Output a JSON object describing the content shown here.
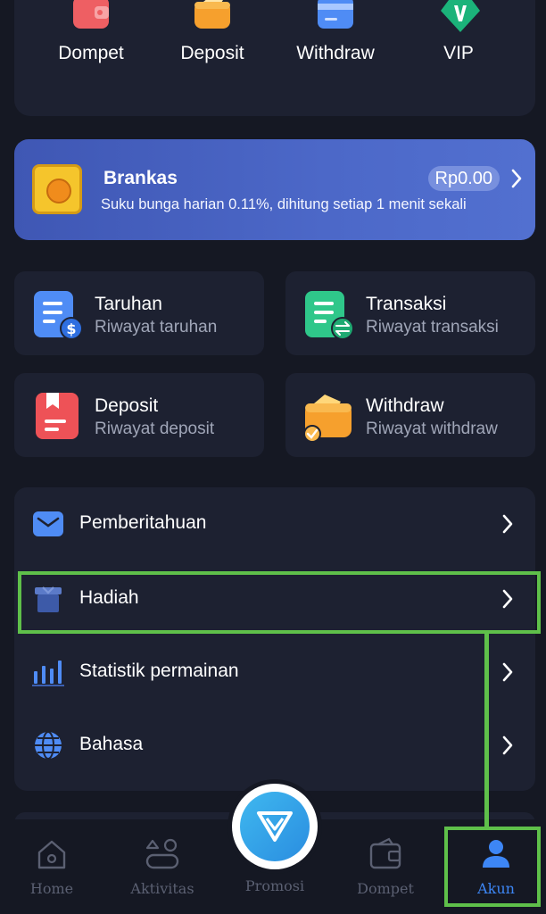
{
  "quick_actions": [
    {
      "label": "Dompet",
      "icon": "wallet-icon",
      "color": "#ee5f63"
    },
    {
      "label": "Deposit",
      "icon": "deposit-icon",
      "color": "#f6a02d"
    },
    {
      "label": "Withdraw",
      "icon": "card-icon",
      "color": "#4f8cf5"
    },
    {
      "label": "VIP",
      "icon": "vip-shield-icon",
      "color": "#1bb37a"
    }
  ],
  "brankas": {
    "title": "Brankas",
    "description": "Suku bunga harian 0.11%, dihitung setiap 1 menit sekali",
    "balance": "Rp0.00",
    "icon": "safe-icon"
  },
  "records": [
    {
      "title": "Taruhan",
      "subtitle": "Riwayat taruhan",
      "icon": "bet-history-icon",
      "color": "#4f8cf5"
    },
    {
      "title": "Transaksi",
      "subtitle": "Riwayat transaksi",
      "icon": "transaction-history-icon",
      "color": "#2fc78a"
    },
    {
      "title": "Deposit",
      "subtitle": "Riwayat deposit",
      "icon": "deposit-history-icon",
      "color": "#ee5257"
    },
    {
      "title": "Withdraw",
      "subtitle": "Riwayat withdraw",
      "icon": "withdraw-history-icon",
      "color": "#f6a02d"
    }
  ],
  "menu": [
    {
      "label": "Pemberitahuan",
      "icon": "mail-icon"
    },
    {
      "label": "Hadiah",
      "icon": "gift-icon"
    },
    {
      "label": "Statistik permainan",
      "icon": "bar-chart-icon"
    },
    {
      "label": "Bahasa",
      "icon": "globe-icon"
    }
  ],
  "bottom_nav": {
    "items": [
      {
        "label": "Home",
        "icon": "home-icon"
      },
      {
        "label": "Aktivitas",
        "icon": "activity-icon"
      },
      {
        "label": "Promosi",
        "icon": "diamond-icon"
      },
      {
        "label": "Dompet",
        "icon": "wallet-icon"
      },
      {
        "label": "Akun",
        "icon": "user-icon"
      }
    ],
    "active": "Akun",
    "active_color": "#3d86f5"
  },
  "colors": {
    "background": "#151823",
    "card": "#1d2131",
    "accent": "#4c68c8",
    "highlight": "#5fc04a"
  }
}
